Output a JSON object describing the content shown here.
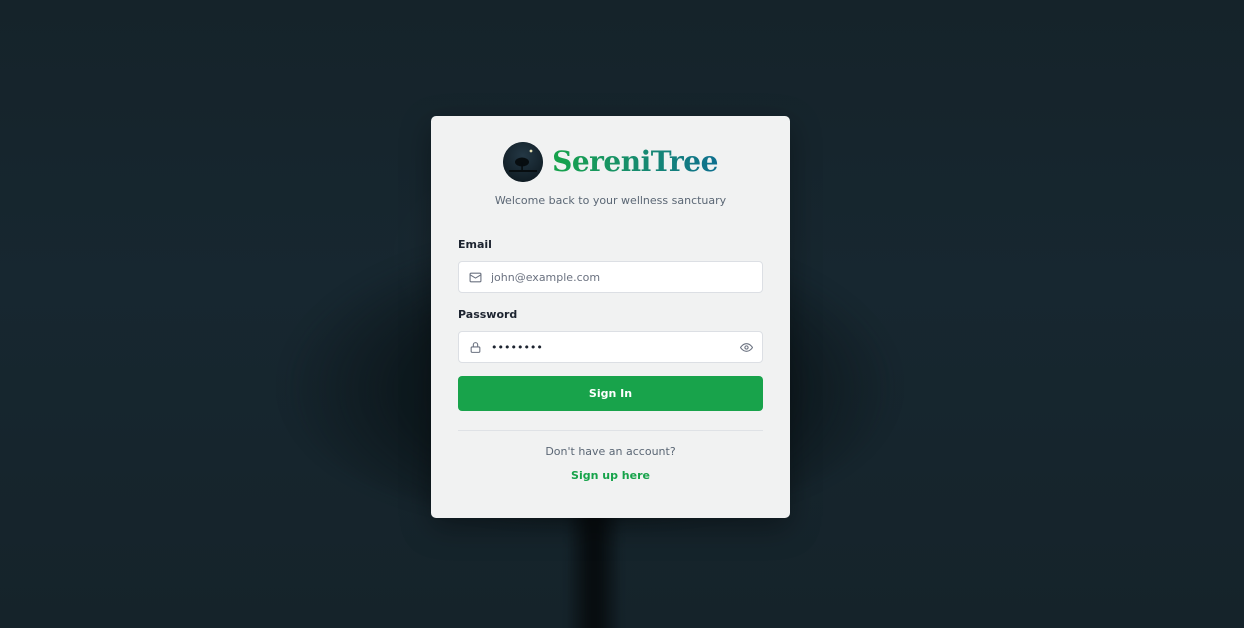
{
  "brand": {
    "name": "SereniTree",
    "tagline": "Welcome back to your wellness sanctuary",
    "logo_icon": "moon-tree-logo-icon"
  },
  "form": {
    "email": {
      "label": "Email",
      "placeholder": "john@example.com",
      "value": "",
      "icon": "mail-icon"
    },
    "password": {
      "label": "Password",
      "value": "••••••••",
      "icon": "lock-icon",
      "toggle_icon": "eye-icon"
    },
    "submit_label": "Sign In"
  },
  "footer": {
    "prompt": "Don't have an account?",
    "signup_link": "Sign up here"
  },
  "colors": {
    "accent": "#18a34b",
    "background": "#16242a",
    "card": "#f1f2f2",
    "brand_gradient_end": "#0e6f8f"
  }
}
